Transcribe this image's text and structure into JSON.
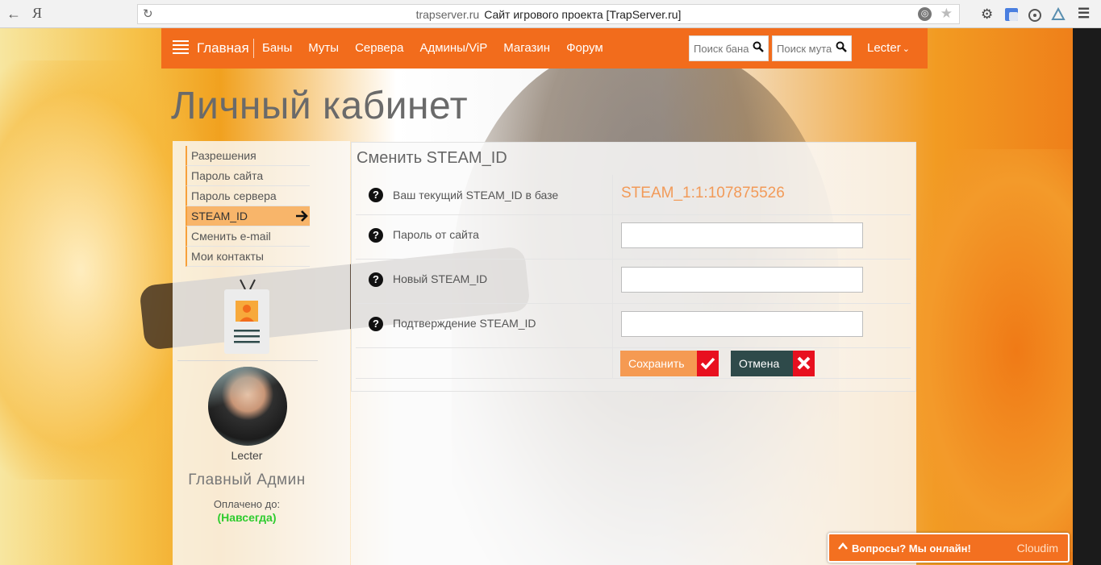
{
  "browser": {
    "host": "trapserver.ru",
    "page_title": "Сайт игрового проекта [TrapServer.ru]",
    "yandex_glyph": "Я"
  },
  "nav": {
    "brand": "Главная",
    "links": [
      "Баны",
      "Муты",
      "Сервера",
      "Админы/ViP",
      "Магазин",
      "Форум"
    ],
    "search_ban_placeholder": "Поиск бана",
    "search_mute_placeholder": "Поиск мута",
    "user": "Lecter"
  },
  "page": {
    "title": "Личный кабинет"
  },
  "sidebar": {
    "items": [
      {
        "label": "Разрешения"
      },
      {
        "label": "Пароль сайта"
      },
      {
        "label": "Пароль сервера"
      },
      {
        "label": "STEAM_ID",
        "active": true
      },
      {
        "label": "Сменить e-mail"
      },
      {
        "label": "Мои контакты"
      }
    ]
  },
  "profile": {
    "name": "Lecter",
    "role": "Главный Админ",
    "paid_label": "Оплачено до:",
    "paid_value": "(Навсегда)"
  },
  "form": {
    "title": "Сменить STEAM_ID",
    "current_label": "Ваш текущий STEAM_ID в базе",
    "current_value": "STEAM_1:1:107875526",
    "password_label": "Пароль от сайта",
    "new_label": "Новый STEAM_ID",
    "confirm_label": "Подтверждение STEAM_ID",
    "save_label": "Сохранить",
    "cancel_label": "Отмена"
  },
  "chat": {
    "text": "Вопросы? Мы онлайн!",
    "brand": "Cloudim"
  },
  "colors": {
    "nav_orange": "#f26c1c",
    "accent_orange": "#f59a52",
    "cancel_dark": "#2e4a4a",
    "icon_red": "#e8101f",
    "paid_green": "#2ecc2e"
  }
}
